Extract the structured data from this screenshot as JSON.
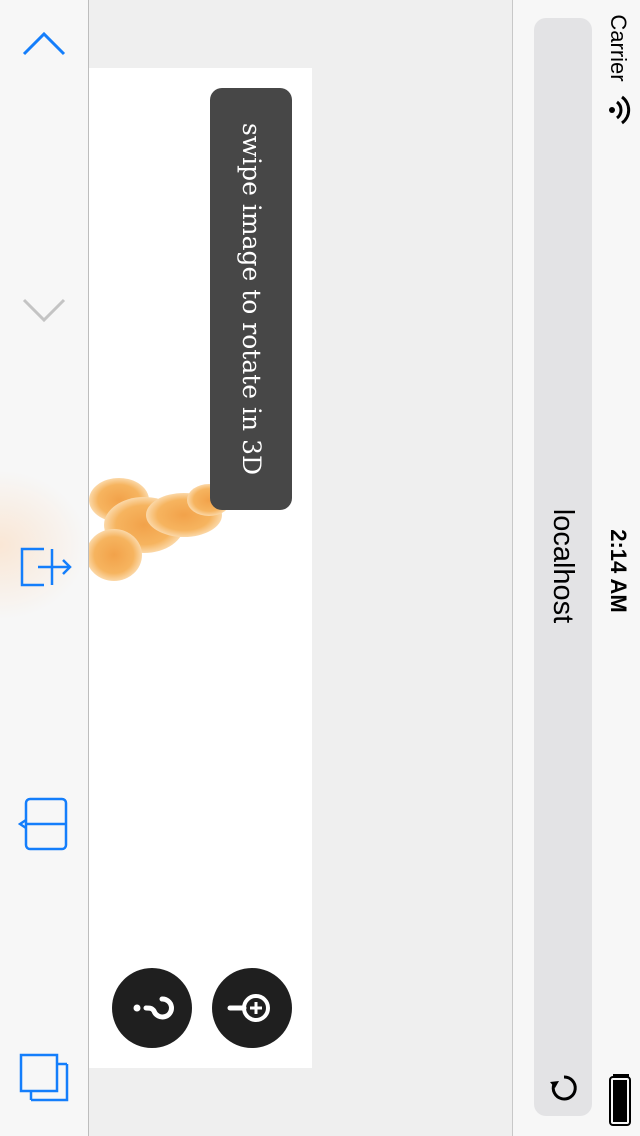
{
  "status": {
    "carrier": "Carrier",
    "time": "2:14 AM"
  },
  "browser": {
    "url": "localhost"
  },
  "viewer": {
    "hint": "swipe image to rotate in 3D"
  },
  "colors": {
    "accent": "#147efb",
    "hint_bg": "#474747",
    "button_bg": "#1f1f1f",
    "url_field_bg": "#e3e3e5"
  },
  "icons": {
    "toolbar": [
      "back-icon",
      "forward-icon",
      "share-icon",
      "bookmarks-icon",
      "tabs-icon"
    ],
    "viewer": [
      "help-icon",
      "zoom-in-icon"
    ],
    "status": [
      "wifi-icon",
      "battery-icon"
    ],
    "browser": [
      "reload-icon"
    ]
  }
}
